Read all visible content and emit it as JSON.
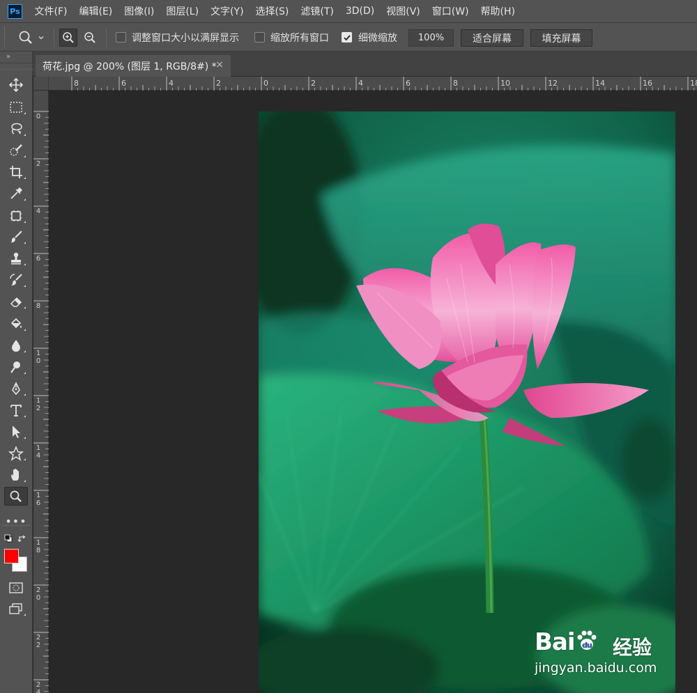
{
  "app": {
    "logo": "Ps"
  },
  "menu": [
    "文件(F)",
    "编辑(E)",
    "图像(I)",
    "图层(L)",
    "文字(Y)",
    "选择(S)",
    "滤镜(T)",
    "3D(D)",
    "视图(V)",
    "窗口(W)",
    "帮助(H)"
  ],
  "options": {
    "resize_windows_label": "调整窗口大小以满屏显示",
    "resize_windows_checked": false,
    "zoom_all_label": "缩放所有窗口",
    "zoom_all_checked": false,
    "scrubby_label": "细微缩放",
    "scrubby_checked": true,
    "zoom_value": "100%",
    "fit_screen_label": "适合屏幕",
    "fill_screen_label": "填充屏幕"
  },
  "toolbar": {
    "collapse_glyph": "»",
    "more_glyph": "•••",
    "foreground_color": "#ff0000",
    "background_color": "#ffffff",
    "tools": [
      "move-icon",
      "marquee-icon",
      "lasso-icon",
      "quick-select-icon",
      "crop-icon",
      "eyedropper-icon",
      "frame-icon",
      "brush-icon",
      "stamp-icon",
      "history-brush-icon",
      "eraser-icon",
      "paint-bucket-icon",
      "blur-icon",
      "dodge-icon",
      "pen-icon",
      "type-icon",
      "path-select-icon",
      "shape-icon",
      "hand-icon",
      "zoom-icon"
    ],
    "active_tool": "zoom-icon"
  },
  "tab": {
    "title": "荷花.jpg @ 200% (图层 1, RGB/8#) *",
    "close": "×"
  },
  "ruler_h": [
    "8",
    "6",
    "4",
    "2",
    "0",
    "2",
    "4",
    "6",
    "8",
    "10",
    "12",
    "14",
    "16",
    "18"
  ],
  "ruler_v": [
    "0",
    "2",
    "4",
    "6",
    "8",
    "1\n0",
    "1\n2",
    "1\n4",
    "1\n6",
    "1\n8",
    "2\n0",
    "2\n2",
    "2\n4"
  ],
  "watermark": {
    "brand": "Bai",
    "brand2": "du",
    "cn": "经验",
    "url": "jingyan.baidu.com"
  }
}
